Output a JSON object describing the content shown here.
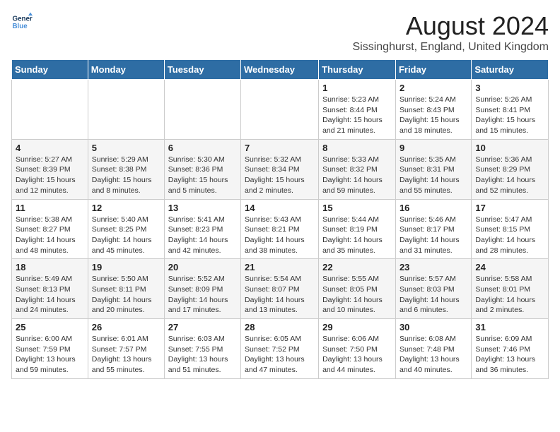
{
  "logo": {
    "line1": "General",
    "line2": "Blue"
  },
  "title": "August 2024",
  "subtitle": "Sissinghurst, England, United Kingdom",
  "weekdays": [
    "Sunday",
    "Monday",
    "Tuesday",
    "Wednesday",
    "Thursday",
    "Friday",
    "Saturday"
  ],
  "weeks": [
    [
      {
        "day": "",
        "info": ""
      },
      {
        "day": "",
        "info": ""
      },
      {
        "day": "",
        "info": ""
      },
      {
        "day": "",
        "info": ""
      },
      {
        "day": "1",
        "info": "Sunrise: 5:23 AM\nSunset: 8:44 PM\nDaylight: 15 hours\nand 21 minutes."
      },
      {
        "day": "2",
        "info": "Sunrise: 5:24 AM\nSunset: 8:43 PM\nDaylight: 15 hours\nand 18 minutes."
      },
      {
        "day": "3",
        "info": "Sunrise: 5:26 AM\nSunset: 8:41 PM\nDaylight: 15 hours\nand 15 minutes."
      }
    ],
    [
      {
        "day": "4",
        "info": "Sunrise: 5:27 AM\nSunset: 8:39 PM\nDaylight: 15 hours\nand 12 minutes."
      },
      {
        "day": "5",
        "info": "Sunrise: 5:29 AM\nSunset: 8:38 PM\nDaylight: 15 hours\nand 8 minutes."
      },
      {
        "day": "6",
        "info": "Sunrise: 5:30 AM\nSunset: 8:36 PM\nDaylight: 15 hours\nand 5 minutes."
      },
      {
        "day": "7",
        "info": "Sunrise: 5:32 AM\nSunset: 8:34 PM\nDaylight: 15 hours\nand 2 minutes."
      },
      {
        "day": "8",
        "info": "Sunrise: 5:33 AM\nSunset: 8:32 PM\nDaylight: 14 hours\nand 59 minutes."
      },
      {
        "day": "9",
        "info": "Sunrise: 5:35 AM\nSunset: 8:31 PM\nDaylight: 14 hours\nand 55 minutes."
      },
      {
        "day": "10",
        "info": "Sunrise: 5:36 AM\nSunset: 8:29 PM\nDaylight: 14 hours\nand 52 minutes."
      }
    ],
    [
      {
        "day": "11",
        "info": "Sunrise: 5:38 AM\nSunset: 8:27 PM\nDaylight: 14 hours\nand 48 minutes."
      },
      {
        "day": "12",
        "info": "Sunrise: 5:40 AM\nSunset: 8:25 PM\nDaylight: 14 hours\nand 45 minutes."
      },
      {
        "day": "13",
        "info": "Sunrise: 5:41 AM\nSunset: 8:23 PM\nDaylight: 14 hours\nand 42 minutes."
      },
      {
        "day": "14",
        "info": "Sunrise: 5:43 AM\nSunset: 8:21 PM\nDaylight: 14 hours\nand 38 minutes."
      },
      {
        "day": "15",
        "info": "Sunrise: 5:44 AM\nSunset: 8:19 PM\nDaylight: 14 hours\nand 35 minutes."
      },
      {
        "day": "16",
        "info": "Sunrise: 5:46 AM\nSunset: 8:17 PM\nDaylight: 14 hours\nand 31 minutes."
      },
      {
        "day": "17",
        "info": "Sunrise: 5:47 AM\nSunset: 8:15 PM\nDaylight: 14 hours\nand 28 minutes."
      }
    ],
    [
      {
        "day": "18",
        "info": "Sunrise: 5:49 AM\nSunset: 8:13 PM\nDaylight: 14 hours\nand 24 minutes."
      },
      {
        "day": "19",
        "info": "Sunrise: 5:50 AM\nSunset: 8:11 PM\nDaylight: 14 hours\nand 20 minutes."
      },
      {
        "day": "20",
        "info": "Sunrise: 5:52 AM\nSunset: 8:09 PM\nDaylight: 14 hours\nand 17 minutes."
      },
      {
        "day": "21",
        "info": "Sunrise: 5:54 AM\nSunset: 8:07 PM\nDaylight: 14 hours\nand 13 minutes."
      },
      {
        "day": "22",
        "info": "Sunrise: 5:55 AM\nSunset: 8:05 PM\nDaylight: 14 hours\nand 10 minutes."
      },
      {
        "day": "23",
        "info": "Sunrise: 5:57 AM\nSunset: 8:03 PM\nDaylight: 14 hours\nand 6 minutes."
      },
      {
        "day": "24",
        "info": "Sunrise: 5:58 AM\nSunset: 8:01 PM\nDaylight: 14 hours\nand 2 minutes."
      }
    ],
    [
      {
        "day": "25",
        "info": "Sunrise: 6:00 AM\nSunset: 7:59 PM\nDaylight: 13 hours\nand 59 minutes."
      },
      {
        "day": "26",
        "info": "Sunrise: 6:01 AM\nSunset: 7:57 PM\nDaylight: 13 hours\nand 55 minutes."
      },
      {
        "day": "27",
        "info": "Sunrise: 6:03 AM\nSunset: 7:55 PM\nDaylight: 13 hours\nand 51 minutes."
      },
      {
        "day": "28",
        "info": "Sunrise: 6:05 AM\nSunset: 7:52 PM\nDaylight: 13 hours\nand 47 minutes."
      },
      {
        "day": "29",
        "info": "Sunrise: 6:06 AM\nSunset: 7:50 PM\nDaylight: 13 hours\nand 44 minutes."
      },
      {
        "day": "30",
        "info": "Sunrise: 6:08 AM\nSunset: 7:48 PM\nDaylight: 13 hours\nand 40 minutes."
      },
      {
        "day": "31",
        "info": "Sunrise: 6:09 AM\nSunset: 7:46 PM\nDaylight: 13 hours\nand 36 minutes."
      }
    ]
  ]
}
